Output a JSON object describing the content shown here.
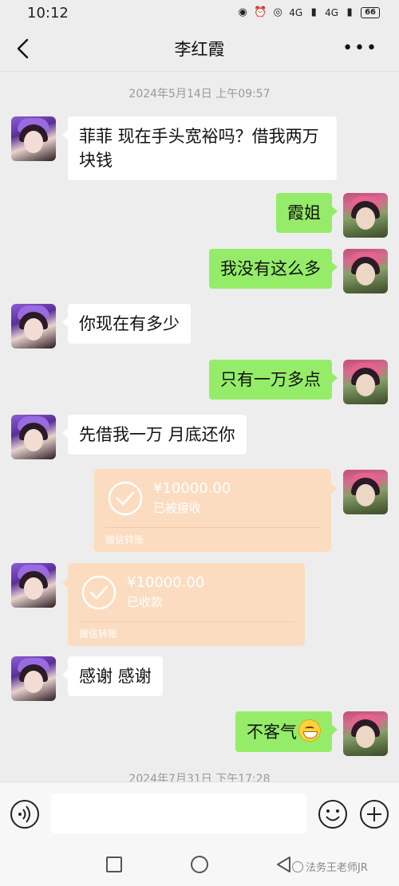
{
  "status_bar": {
    "time": "10:12",
    "network": "4G",
    "battery": "66"
  },
  "header": {
    "title": "李红霞"
  },
  "messages": {
    "timestamp_1": "2024年5月14日 上午09:57",
    "m1": "菲菲  现在手头宽裕吗？借我两万块钱",
    "m2": "霞姐",
    "m3": "我没有这么多",
    "m4": "你现在有多少",
    "m5": "只有一万多点",
    "m6": "先借我一万  月底还你",
    "transfer_sent": {
      "amount": "¥10000.00",
      "status": "已被接收",
      "label": "微信转账"
    },
    "transfer_received": {
      "amount": "¥10000.00",
      "status": "已收款",
      "label": "微信转账"
    },
    "m7": "感谢  感谢",
    "m8": "不客气",
    "timestamp_2": "2024年7月31日 下午17:28"
  },
  "input_bar": {
    "placeholder": ""
  },
  "watermark": "法务王老师JR",
  "colors": {
    "background": "#ededed",
    "sent_bubble": "#95ec69",
    "received_bubble": "#ffffff",
    "transfer_card": "#fcdcc0"
  }
}
